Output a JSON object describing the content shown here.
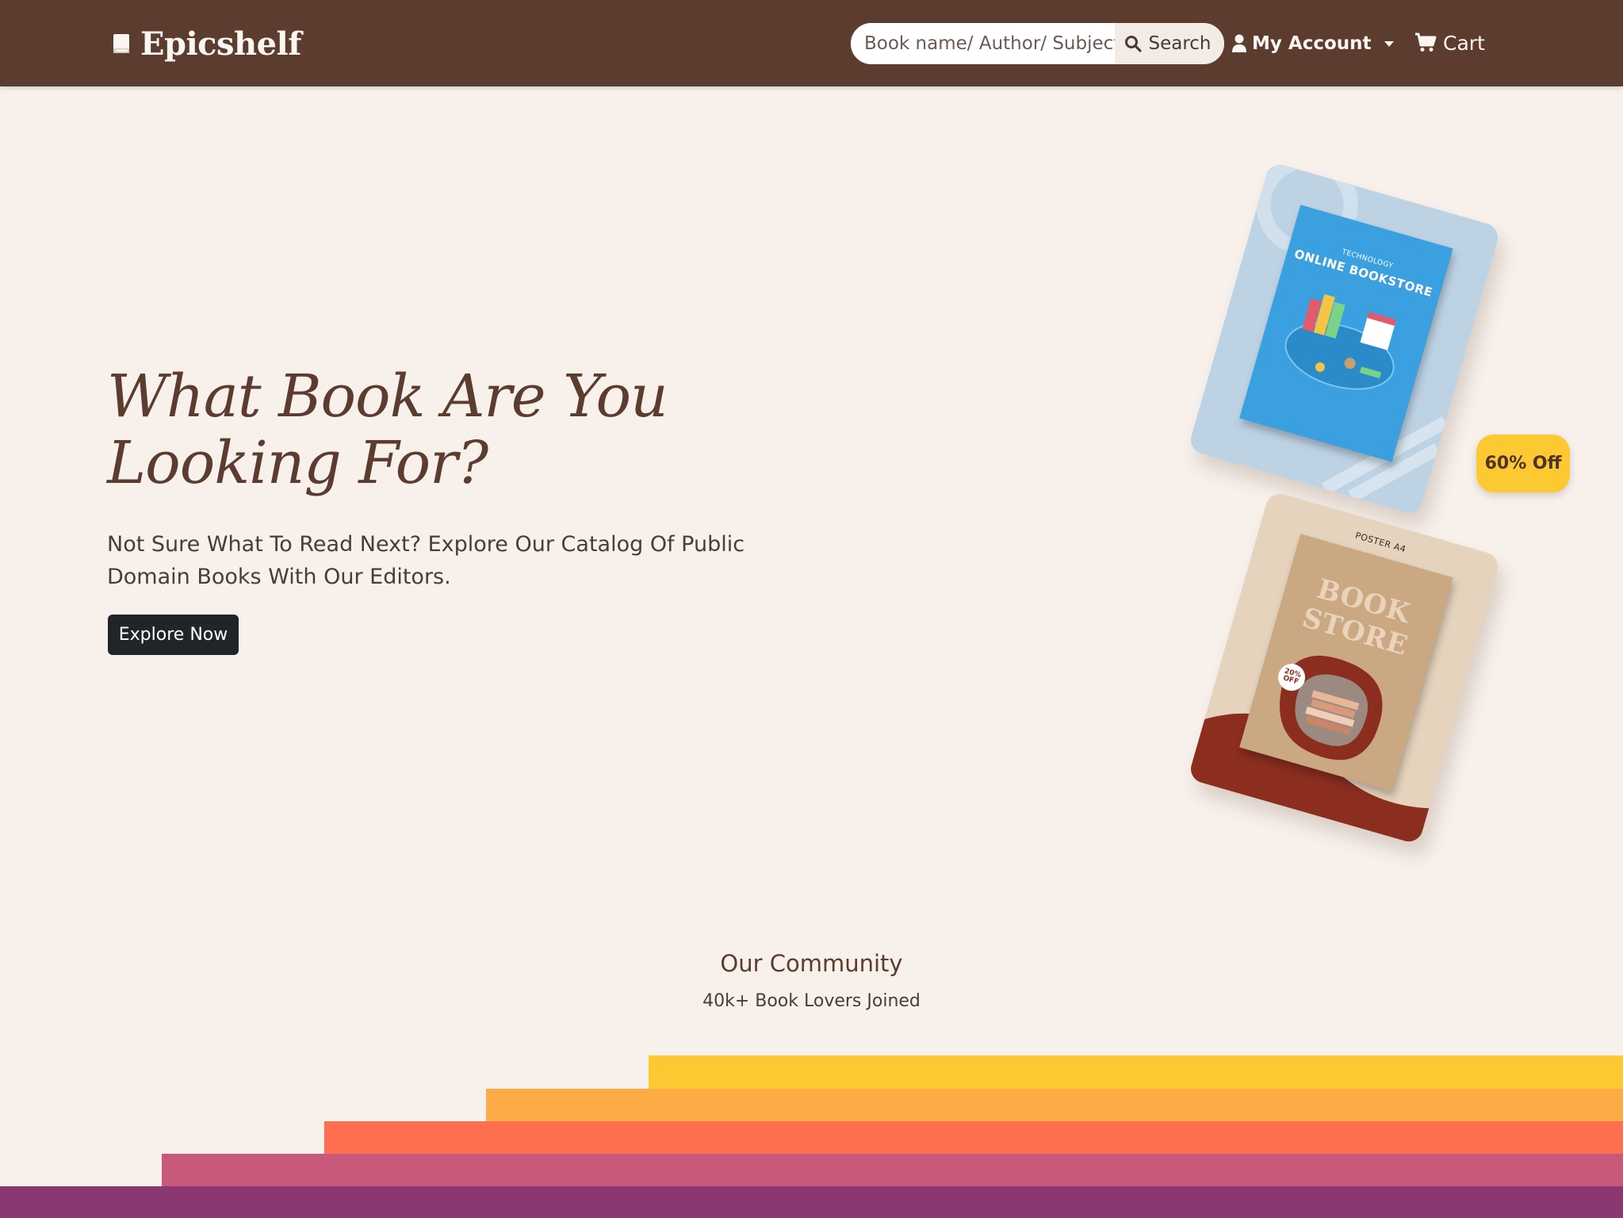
{
  "navbar": {
    "brand": "Epicshelf",
    "search": {
      "placeholder": "Book name/ Author/ Subject",
      "button_label": "Search"
    },
    "account_label": "My Account",
    "cart_label": "Cart"
  },
  "hero": {
    "title": "What Book Are You Looking For?",
    "subtitle": "Not Sure What To Read Next? Explore Our Catalog Of Public Domain Books With Our Editors.",
    "cta_label": "Explore Now"
  },
  "cards": {
    "card1": {
      "small": "TECHNOLOGY",
      "title": "ONLINE BOOKSTORE"
    },
    "card2": {
      "small": "POSTER A4",
      "title": "BOOK STORE",
      "discount": "20% OFF"
    }
  },
  "badge": "60% Off",
  "community": {
    "title": "Our Community",
    "subtitle": "40k+ Book Lovers Joined"
  },
  "colors": {
    "navbar": "#5c3c2f",
    "background": "#f7f0eb",
    "stripes": [
      "#fdc932",
      "#fdab46",
      "#fd6f4e",
      "#c9597a",
      "#8b3872"
    ]
  }
}
